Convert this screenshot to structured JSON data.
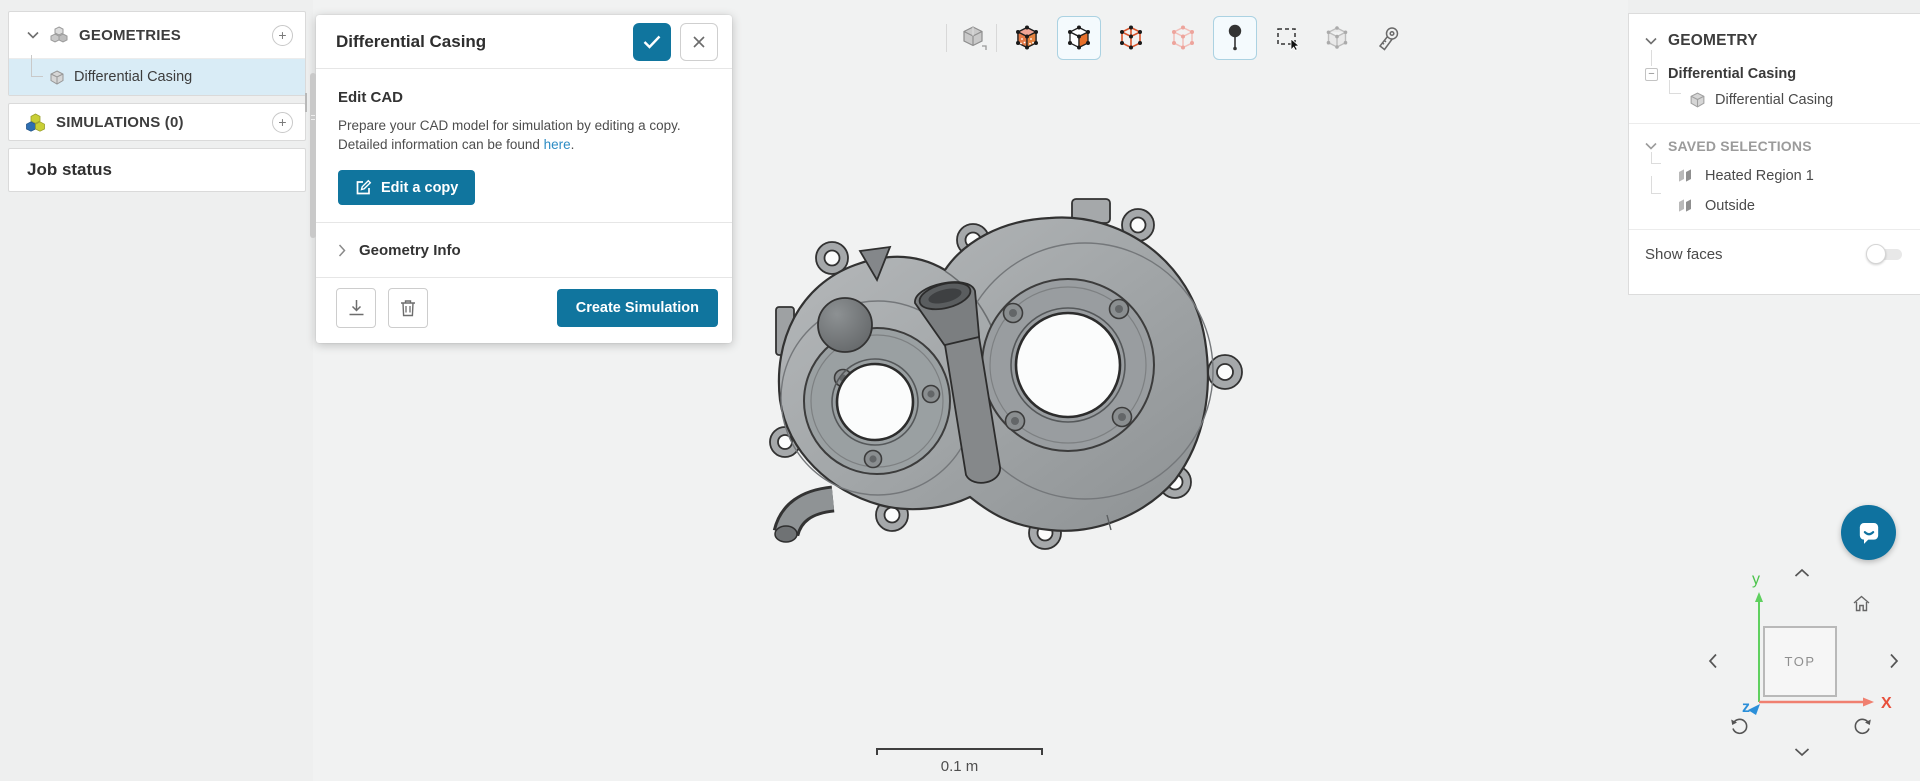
{
  "app": {
    "accent_color": "#10759e",
    "link_color": "#2d8cc4",
    "selection_highlight_color": "#d9ecf6",
    "canvas_background": "#f1f2f2"
  },
  "left_sidebar": {
    "geometries_header": {
      "label": "GEOMETRIES",
      "add_button": "+",
      "icon": "cubes-stack-icon"
    },
    "geometry_items": [
      {
        "label": "Differential Casing",
        "selected": true,
        "icon": "cube-icon"
      }
    ],
    "simulations_header": {
      "label": "SIMULATIONS (0)",
      "add_button": "+",
      "icon": "simulation-cubes-icon"
    },
    "job_status_label": "Job status"
  },
  "edit_dialog": {
    "title": "Differential Casing",
    "confirm_button_icon": "check-icon",
    "close_button_icon": "close-icon",
    "edit_cad": {
      "heading": "Edit CAD",
      "description_before_link": "Prepare your CAD model for simulation by editing a copy. Detailed information can be found ",
      "link_text": "here",
      "description_after_link": ".",
      "edit_copy_button": "Edit a copy"
    },
    "geometry_info_label": "Geometry Info",
    "footer": {
      "download_button_icon": "download-icon",
      "delete_button_icon": "trash-icon",
      "create_simulation_button": "Create Simulation"
    }
  },
  "viewport_toolbar": {
    "buttons": [
      {
        "name": "select-bodies",
        "state": "default"
      },
      {
        "name": "select-volumes",
        "state": "default"
      },
      {
        "name": "select-faces",
        "state": "active"
      },
      {
        "name": "select-edges",
        "state": "default"
      },
      {
        "name": "select-vertices",
        "state": "disabled"
      },
      {
        "name": "probe-point",
        "state": "active"
      },
      {
        "name": "box-select",
        "state": "default"
      },
      {
        "name": "select-assembly",
        "state": "disabled"
      },
      {
        "name": "measure",
        "state": "default"
      }
    ]
  },
  "right_panel": {
    "geometry_header": "GEOMETRY",
    "tree": {
      "parent": "Differential Casing",
      "child": "Differential Casing"
    },
    "saved_selections_header": "SAVED SELECTIONS",
    "saved_selections": [
      {
        "label": "Heated Region 1"
      },
      {
        "label": "Outside"
      }
    ],
    "show_faces": {
      "label": "Show faces",
      "enabled": false
    }
  },
  "viewport": {
    "model_name": "Differential Casing",
    "scale_bar": {
      "label": "0.1 m"
    },
    "navigation": {
      "cube_face_label": "TOP",
      "x_axis_label": "X",
      "y_axis_label": "y",
      "z_axis_label": "z"
    }
  }
}
